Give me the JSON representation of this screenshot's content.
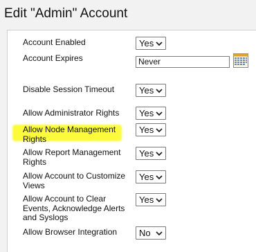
{
  "page": {
    "title": "Edit \"Admin\" Account"
  },
  "fields": {
    "account_enabled": {
      "label": "Account Enabled",
      "value": "Yes"
    },
    "account_expires": {
      "label": "Account Expires",
      "value": "Never"
    },
    "disable_session_timeout": {
      "label": "Disable Session Timeout",
      "value": "Yes"
    },
    "allow_admin_rights": {
      "label": "Allow Administrator Rights",
      "value": "Yes"
    },
    "allow_node_mgmt": {
      "label": "Allow Node Management Rights",
      "value": "Yes"
    },
    "allow_report_mgmt": {
      "label": "Allow Report Management Rights",
      "value": "Yes"
    },
    "allow_customize_views": {
      "label": "Allow Account to Customize Views",
      "value": "Yes"
    },
    "allow_clear_events": {
      "label": "Allow Account to Clear Events, Acknowledge Alerts and Syslogs",
      "value": "Yes"
    },
    "allow_browser_integration": {
      "label": "Allow Browser Integration",
      "value": "No"
    }
  },
  "icons": {
    "calendar": "calendar-icon",
    "dropdown": "chevron-down-icon"
  },
  "colors": {
    "highlight": "#fbfb3c",
    "panel": "#ffffff",
    "background": "#f2f2f2"
  }
}
